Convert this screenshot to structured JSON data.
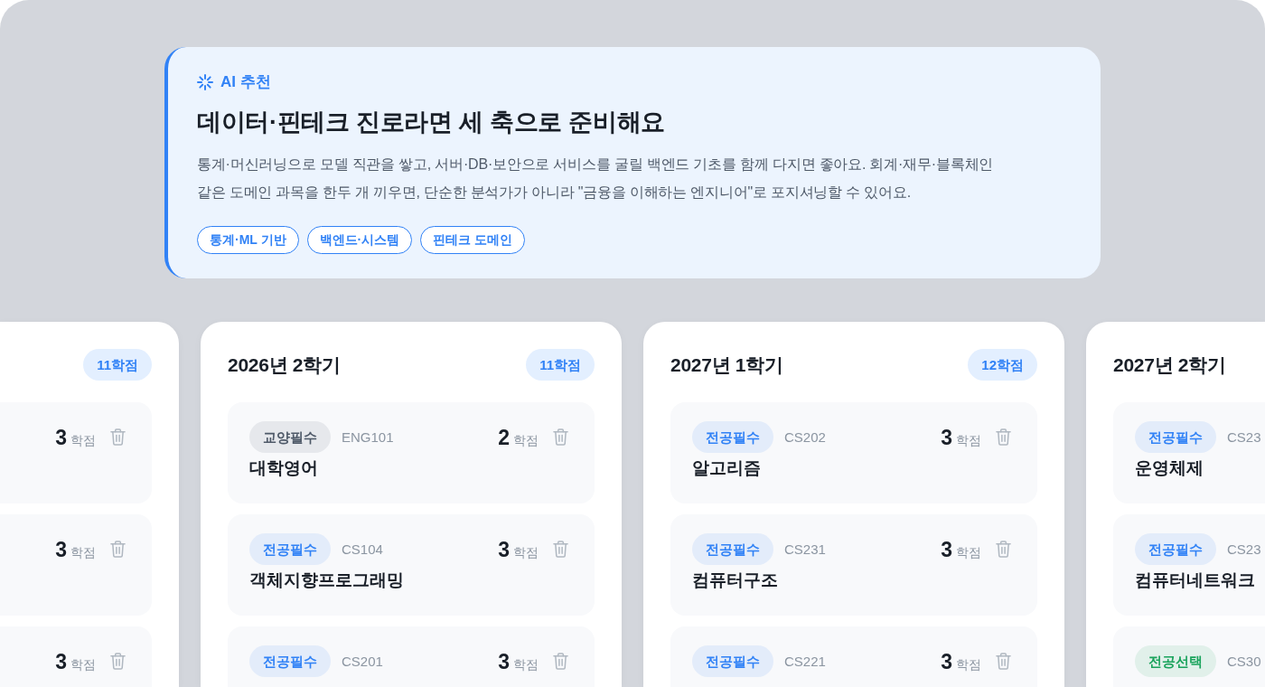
{
  "recommendation": {
    "label": "AI 추천",
    "title": "데이터·핀테크 진로라면 세 축으로 준비해요",
    "body": "통계·머신러닝으로 모델 직관을 쌓고, 서버·DB·보안으로 서비스를 굴릴 백엔드 기초를 함께 다지면 좋아요. 회계·재무·블록체인 같은 도메인 과목을 한두 개 끼우면, 단순한 분석가가 아니라 \"금융을 이해하는 엔지니어\"로 포지셔닝할 수 있어요.",
    "chips": [
      "통계·ML 기반",
      "백엔드·시스템",
      "핀테크 도메인"
    ]
  },
  "semesters": [
    {
      "credit_total": "11학점",
      "courses": [
        {
          "credits": "3",
          "credit_unit": "학점"
        },
        {
          "credits": "3",
          "credit_unit": "학점"
        },
        {
          "credits": "3",
          "credit_unit": "학점"
        }
      ]
    },
    {
      "title": "2026년 2학기",
      "credit_total": "11학점",
      "courses": [
        {
          "category": {
            "label": "교양필수",
            "color": "#4e5968"
          },
          "code": "ENG101",
          "credits": "2",
          "credit_unit": "학점",
          "name": "대학영어"
        },
        {
          "category": {
            "label": "전공필수",
            "color": "#3182f6"
          },
          "code": "CS104",
          "credits": "3",
          "credit_unit": "학점",
          "name": "객체지향프로그래밍"
        },
        {
          "category": {
            "label": "전공필수",
            "color": "#3182f6"
          },
          "code": "CS201",
          "credits": "3",
          "credit_unit": "학점"
        }
      ]
    },
    {
      "title": "2027년 1학기",
      "credit_total": "12학점",
      "courses": [
        {
          "category": {
            "label": "전공필수",
            "color": "#3182f6"
          },
          "code": "CS202",
          "credits": "3",
          "credit_unit": "학점",
          "name": "알고리즘"
        },
        {
          "category": {
            "label": "전공필수",
            "color": "#3182f6"
          },
          "code": "CS231",
          "credits": "3",
          "credit_unit": "학점",
          "name": "컴퓨터구조"
        },
        {
          "category": {
            "label": "전공필수",
            "color": "#3182f6"
          },
          "code": "CS221",
          "credits": "3",
          "credit_unit": "학점"
        }
      ]
    },
    {
      "title": "2027년 2학기",
      "courses": [
        {
          "category": {
            "label": "전공필수",
            "color": "#3182f6"
          },
          "code": "CS23",
          "name": "운영체제"
        },
        {
          "category": {
            "label": "전공필수",
            "color": "#3182f6"
          },
          "code": "CS23",
          "name": "컴퓨터네트워크"
        },
        {
          "category": {
            "label": "전공선택",
            "color": "#1aa35c"
          },
          "code": "CS30"
        }
      ]
    }
  ]
}
